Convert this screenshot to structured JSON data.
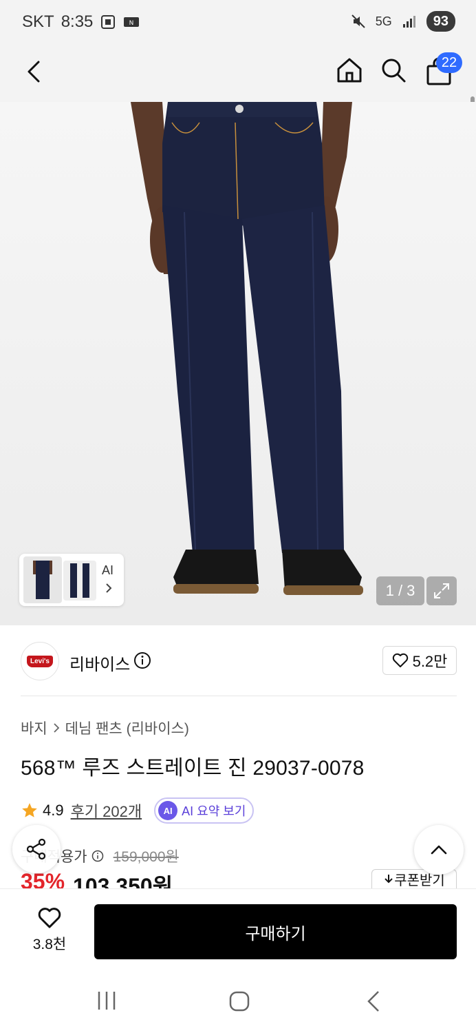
{
  "status_bar": {
    "carrier": "SKT",
    "time": "8:35",
    "network": "5G",
    "battery": "93"
  },
  "app_bar": {
    "cart_count": "22"
  },
  "product_image": {
    "ai_label": "AI",
    "page_indicator": "1 / 3"
  },
  "brand": {
    "logo_text": "Levi's",
    "name": "리바이스",
    "like_count": "5.2만"
  },
  "breadcrumb": {
    "category": "바지",
    "subcategory": "데님 팬츠 (리바이스)"
  },
  "product": {
    "title": "568™ 루즈 스트레이트 진 29037-0078",
    "rating": "4.9",
    "review_link": "후기 202개",
    "ai_summary_badge": "AI",
    "ai_summary_label": "AI 요약 보기",
    "price_label": "구매적용가",
    "original_price": "159,000원",
    "discount": "35%",
    "sale_price": "103,350원",
    "coupon_label": "쿠폰받기"
  },
  "bottom_bar": {
    "wish_count": "3.8천",
    "buy_label": "구매하기"
  },
  "colors": {
    "accent_blue": "#2f6bff",
    "discount_red": "#e3252b",
    "ai_purple": "#6b58e8",
    "buy_button": "#000000"
  }
}
